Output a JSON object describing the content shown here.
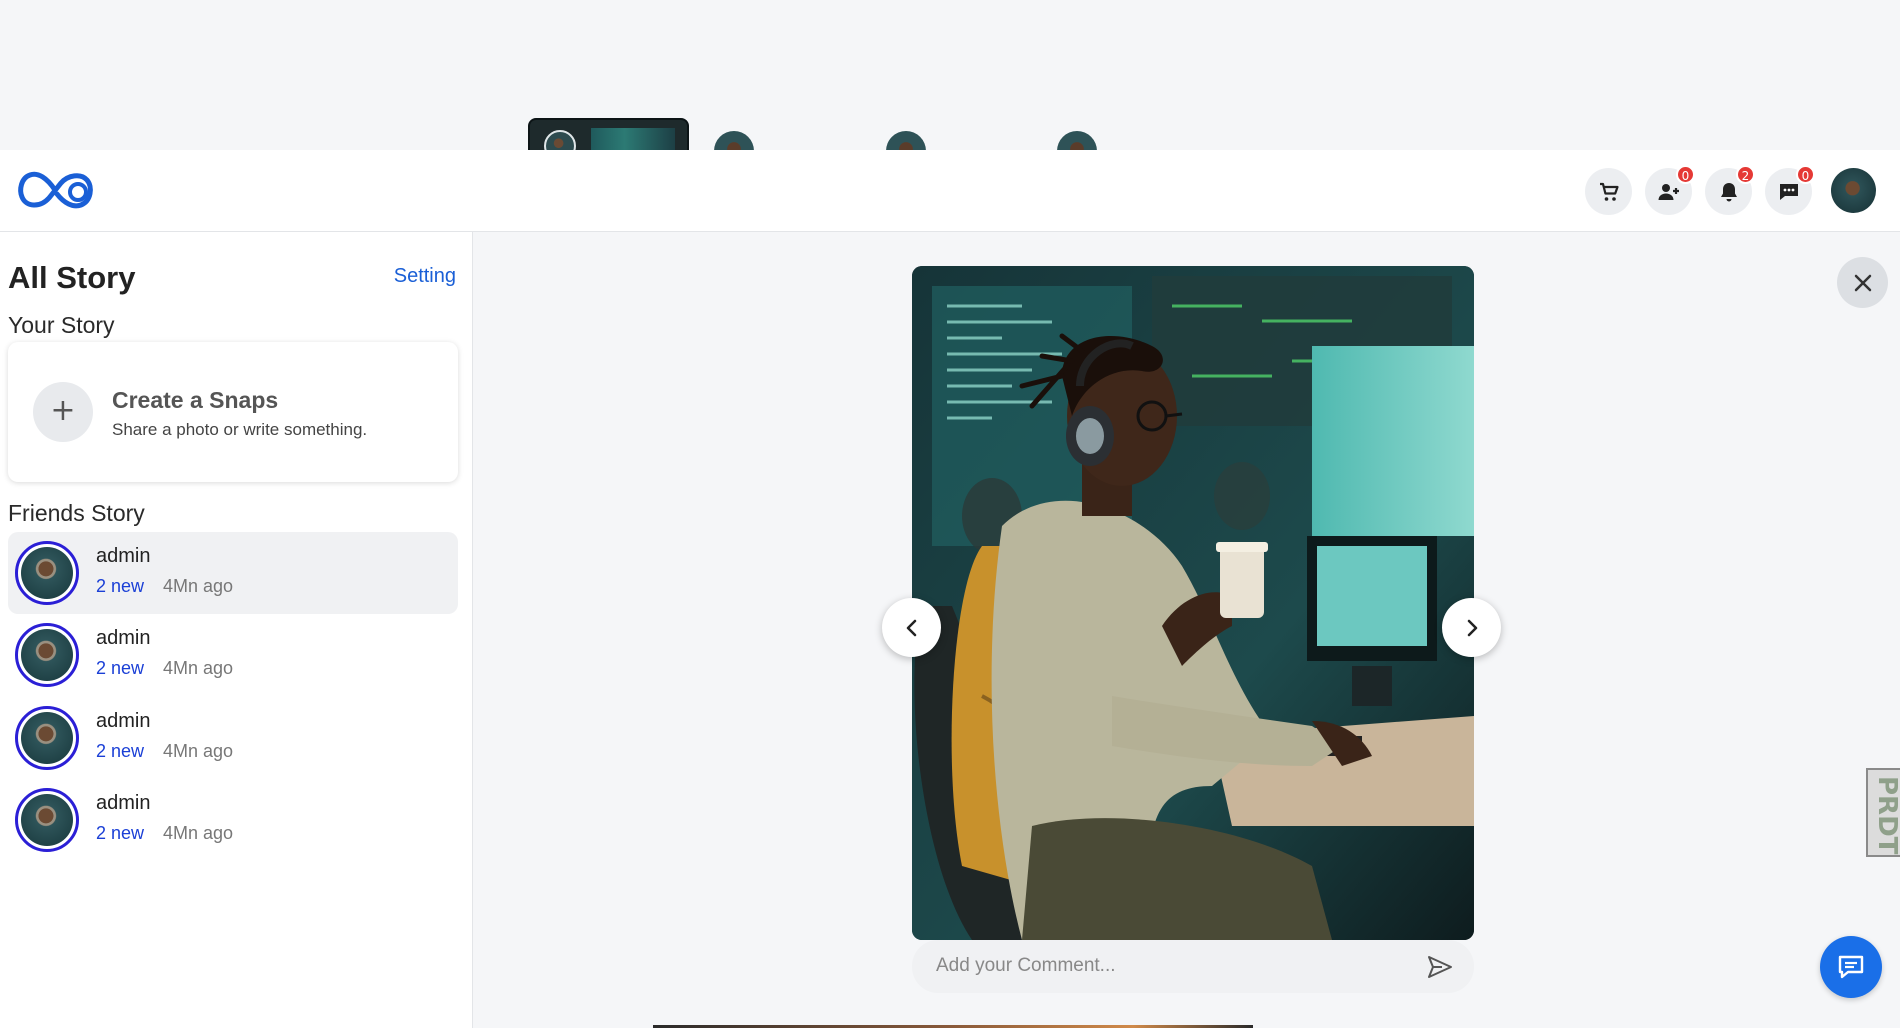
{
  "header": {
    "logo_name": "infinity-logo",
    "icons": [
      {
        "name": "cart-icon",
        "badge": null
      },
      {
        "name": "add-friend-icon",
        "badge": "0"
      },
      {
        "name": "bell-icon",
        "badge": "2"
      },
      {
        "name": "message-icon",
        "badge": "0"
      }
    ]
  },
  "sidebar": {
    "title": "All Story",
    "setting_label": "Setting",
    "your_story_heading": "Your Story",
    "create": {
      "plus": "+",
      "title": "Create a Snaps",
      "subtitle": "Share a photo or write something."
    },
    "friends_heading": "Friends Story",
    "friends": [
      {
        "name": "admin",
        "new": "2 new",
        "time": "4Mn ago"
      },
      {
        "name": "admin",
        "new": "2 new",
        "time": "4Mn ago"
      },
      {
        "name": "admin",
        "new": "2 new",
        "time": "4Mn ago"
      },
      {
        "name": "admin",
        "new": "2 new",
        "time": "4Mn ago"
      }
    ]
  },
  "viewer": {
    "comment_placeholder": "Add your Comment..."
  },
  "side_tab_text": "PRDT",
  "colors": {
    "accent": "#1a5fd6",
    "badge": "#e53935",
    "ring": "#2b1fd6",
    "fab": "#1a6fe8"
  }
}
